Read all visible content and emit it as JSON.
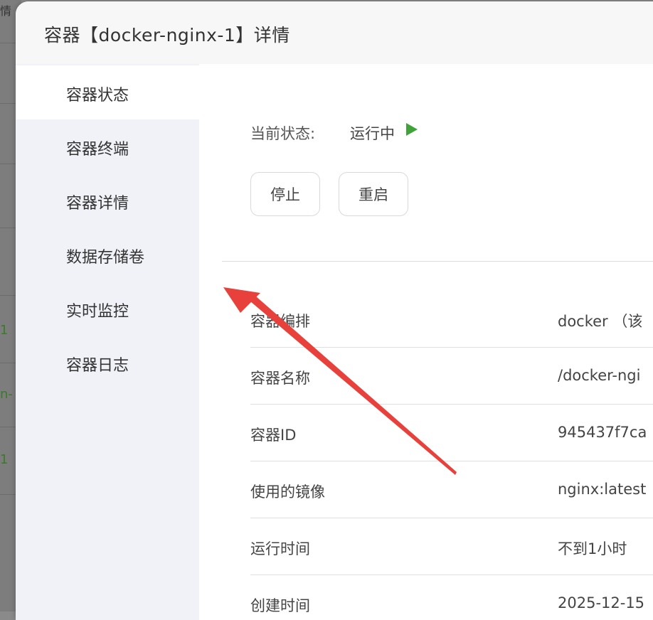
{
  "background": {
    "cells": [
      "1",
      "n-",
      "1"
    ],
    "top_fragment": "情"
  },
  "dialog": {
    "title": "容器【docker-nginx-1】详情"
  },
  "sidebar": {
    "items": [
      {
        "label": "容器状态",
        "active": true
      },
      {
        "label": "容器终端"
      },
      {
        "label": "容器详情"
      },
      {
        "label": "数据存储卷"
      },
      {
        "label": "实时监控"
      },
      {
        "label": "容器日志"
      }
    ]
  },
  "status": {
    "label": "当前状态:",
    "value": "运行中"
  },
  "buttons": {
    "stop": "停止",
    "restart": "重启"
  },
  "details": [
    {
      "key": "容器编排",
      "value": "docker （该"
    },
    {
      "key": "容器名称",
      "value": "/docker-ngi"
    },
    {
      "key": "容器ID",
      "value": "945437f7ca"
    },
    {
      "key": "使用的镜像",
      "value": "nginx:latest"
    },
    {
      "key": "运行时间",
      "value": "不到1小时"
    },
    {
      "key": "创建时间",
      "value": "2025-12-15"
    }
  ],
  "colors": {
    "running": "#3fa33a",
    "annotation_arrow": "#e8403a"
  }
}
